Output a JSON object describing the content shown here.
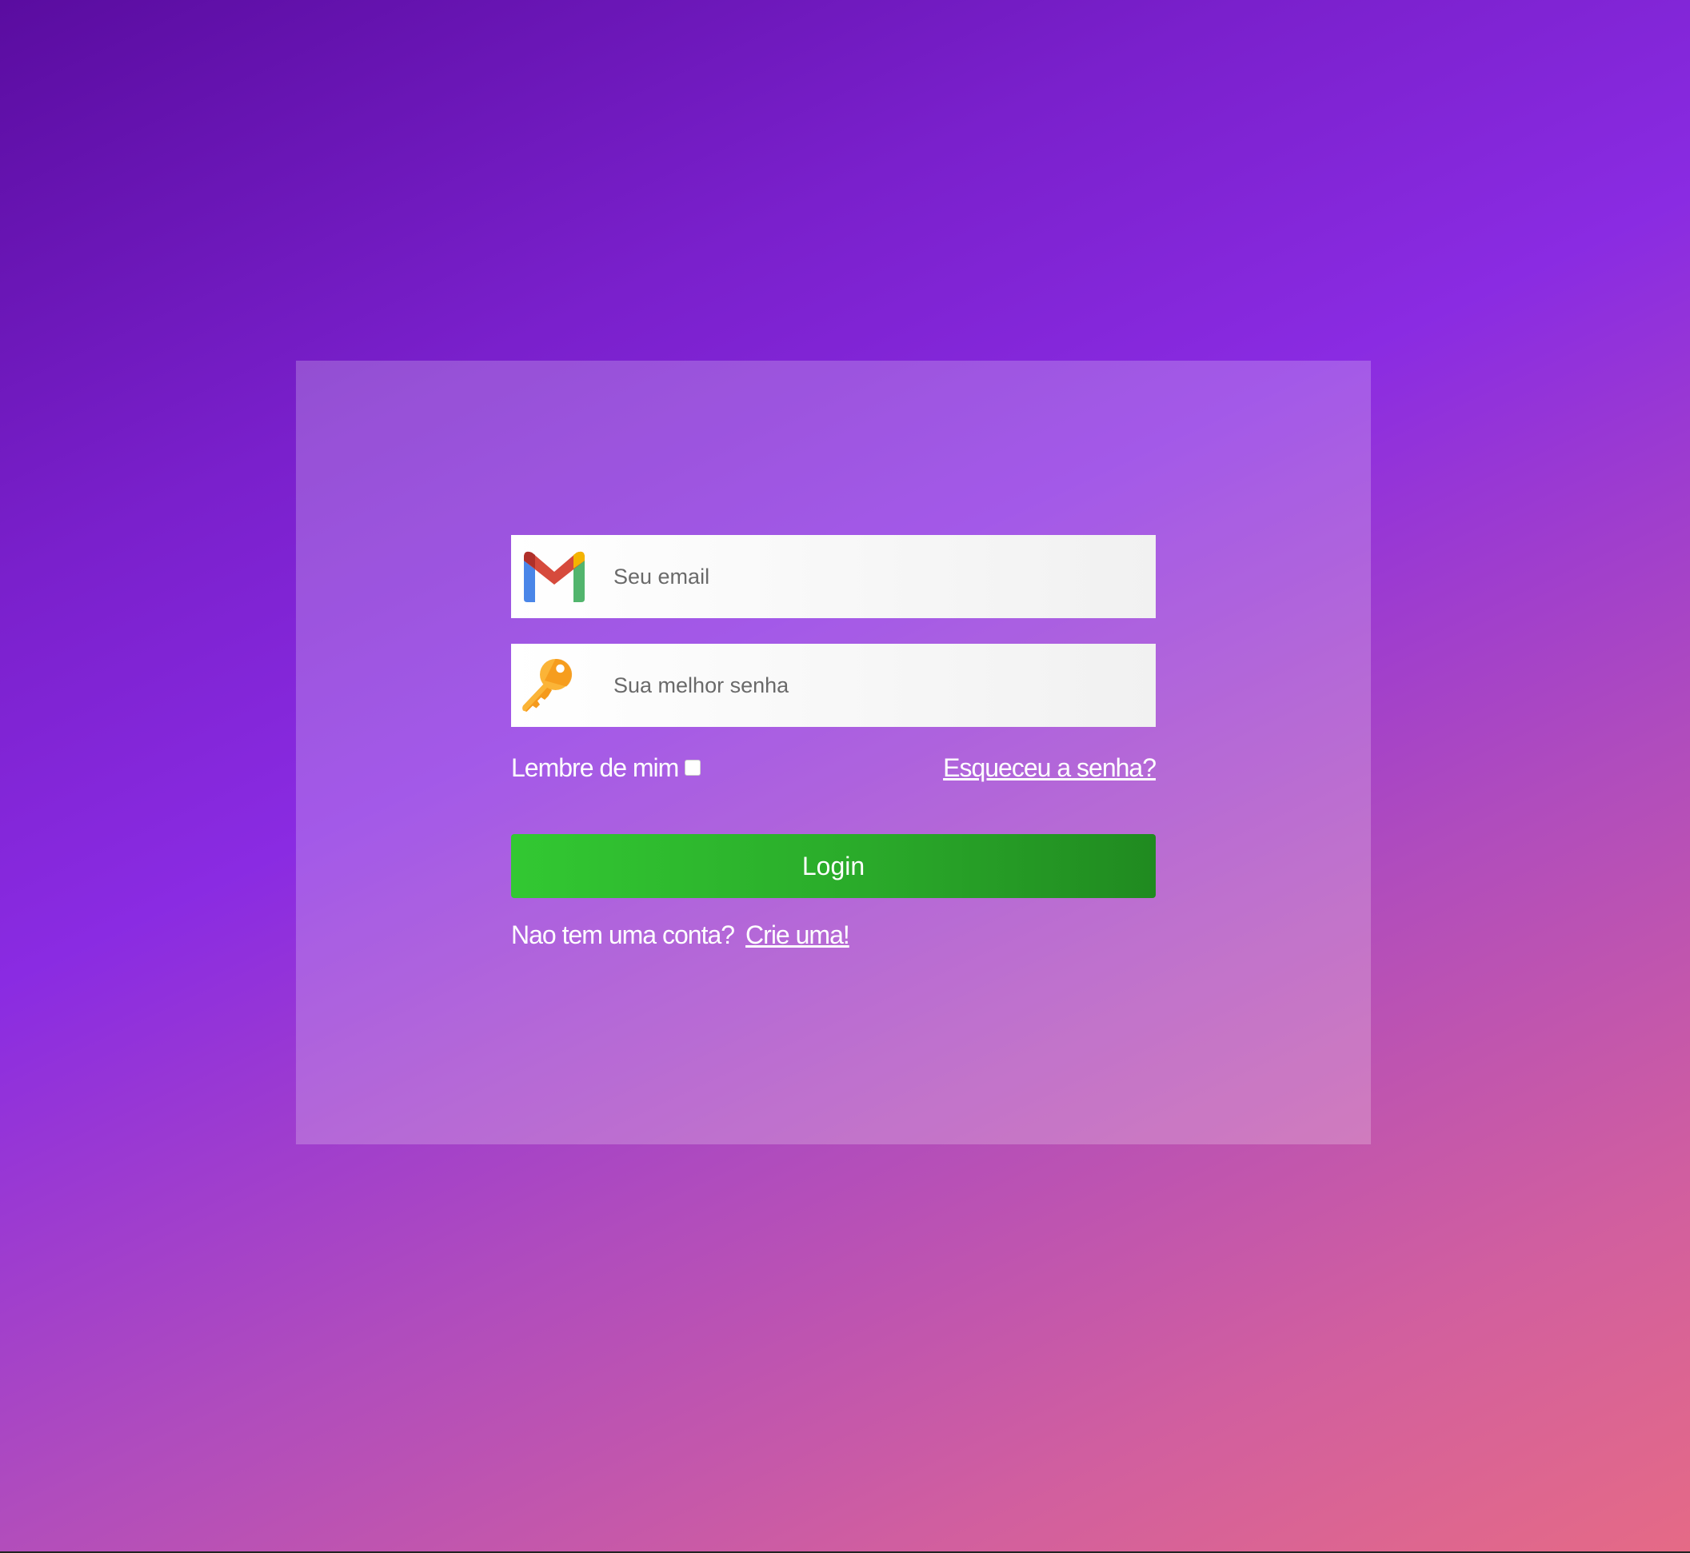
{
  "login_form": {
    "email": {
      "icon": "gmail-icon",
      "placeholder": "Seu email",
      "value": ""
    },
    "password": {
      "icon": "key-icon",
      "placeholder": "Sua melhor senha",
      "value": ""
    },
    "remember_label": "Lembre de mim",
    "remember_checked": false,
    "forgot_label": "Esqueceu a senha?",
    "login_label": "Login",
    "no_account_text": "Nao tem uma conta?",
    "signup_label": "Crie uma!"
  },
  "colors": {
    "login_button_start": "#32c832",
    "login_button_end": "#208a20",
    "background_top": "#5a0ca0",
    "background_mid": "#8a2be2",
    "background_bottom": "#e56a86"
  }
}
